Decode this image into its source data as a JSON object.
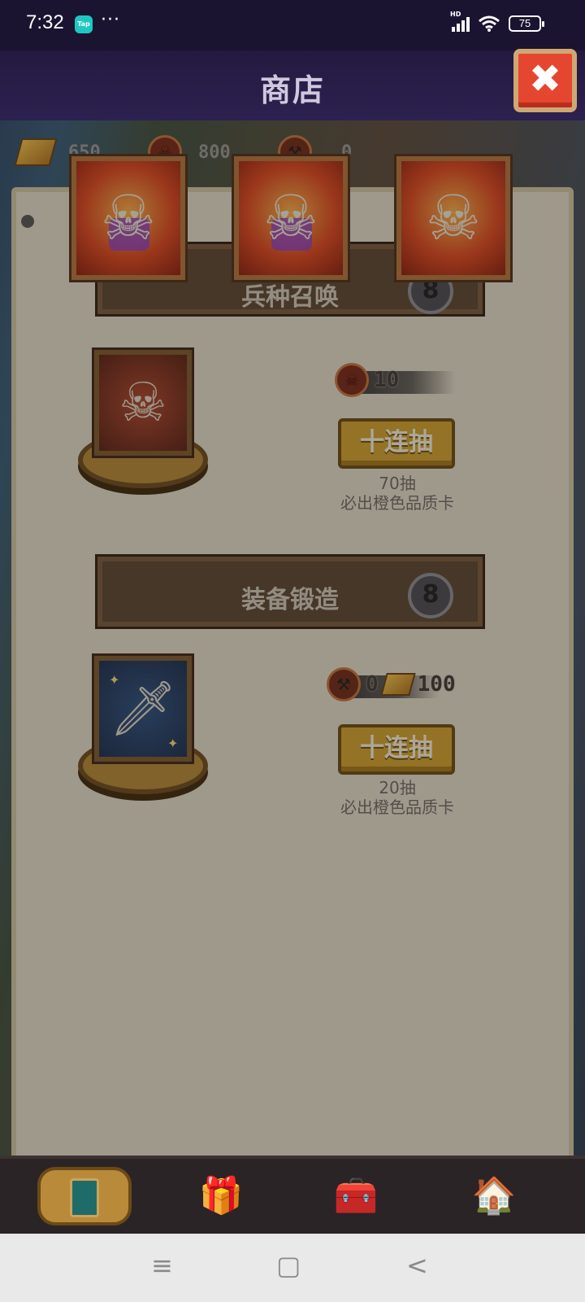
{
  "status_bar": {
    "time": "7:32",
    "app_badge": "Tap",
    "more": "···",
    "network": "HD",
    "battery": "75"
  },
  "header": {
    "title": "商店",
    "close_icon": "✖"
  },
  "currency": {
    "gold": "650",
    "skull_tokens": "800",
    "anvil_tokens": "0"
  },
  "preview_cards": [
    {
      "icon": "skeleton-warrior-purple"
    },
    {
      "icon": "skeleton-warrior-purple"
    },
    {
      "icon": "skeleton-warrior"
    }
  ],
  "sections": [
    {
      "title": "兵种召唤",
      "badge": "8",
      "cost_icon": "skull-coin-icon",
      "cost": "10",
      "button_label": "十连抽",
      "note_line1": "70抽",
      "note_line2": "必出橙色品质卡"
    },
    {
      "title": "装备锻造",
      "badge": "8",
      "cost_icon": "anvil-coin-icon",
      "cost": "0",
      "cost2_icon": "gold-bar-icon",
      "cost2": "100",
      "button_label": "十连抽",
      "note_line1": "20抽",
      "note_line2": "必出橙色品质卡"
    }
  ],
  "tabs": [
    {
      "name": "summon-card",
      "icon": "card-icon"
    },
    {
      "name": "gift",
      "icon": "gift-icon"
    },
    {
      "name": "treasure",
      "icon": "chest-icon"
    },
    {
      "name": "building",
      "icon": "house-icon"
    }
  ],
  "nav": {
    "menu": "≡",
    "home": "▢",
    "back": "<"
  }
}
